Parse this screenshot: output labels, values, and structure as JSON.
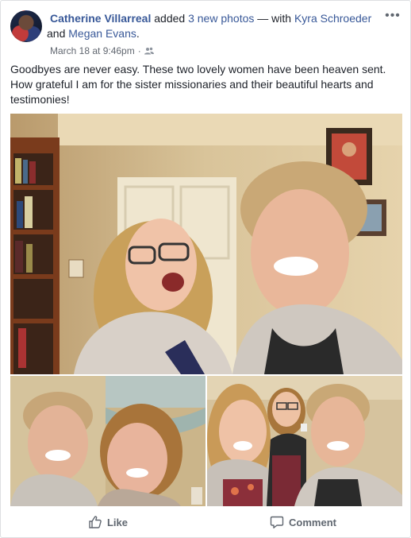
{
  "post": {
    "author": "Catherine Villarreal",
    "action_text": " added ",
    "photos_link": "3 new photos",
    "with_text": " — with ",
    "tagged_1": "Kyra Schroeder",
    "and_text": " and ",
    "tagged_2": "Megan Evans",
    "period": ".",
    "timestamp": "March 18 at 9:46pm",
    "privacy_icon": "friends-icon",
    "more_icon": "ellipsis-icon",
    "more_label": "•••",
    "text": "Goodbyes are never easy. These two lovely women have been heaven sent. How grateful I am for the sister missionaries and their beautiful hearts and testimonies!"
  },
  "actions": {
    "like_label": "Like",
    "like_icon": "thumbs-up-icon",
    "comment_label": "Comment",
    "comment_icon": "comment-icon"
  },
  "colors": {
    "link": "#385898",
    "text": "#1d2129",
    "muted": "#616770",
    "border": "#dddfe2"
  }
}
